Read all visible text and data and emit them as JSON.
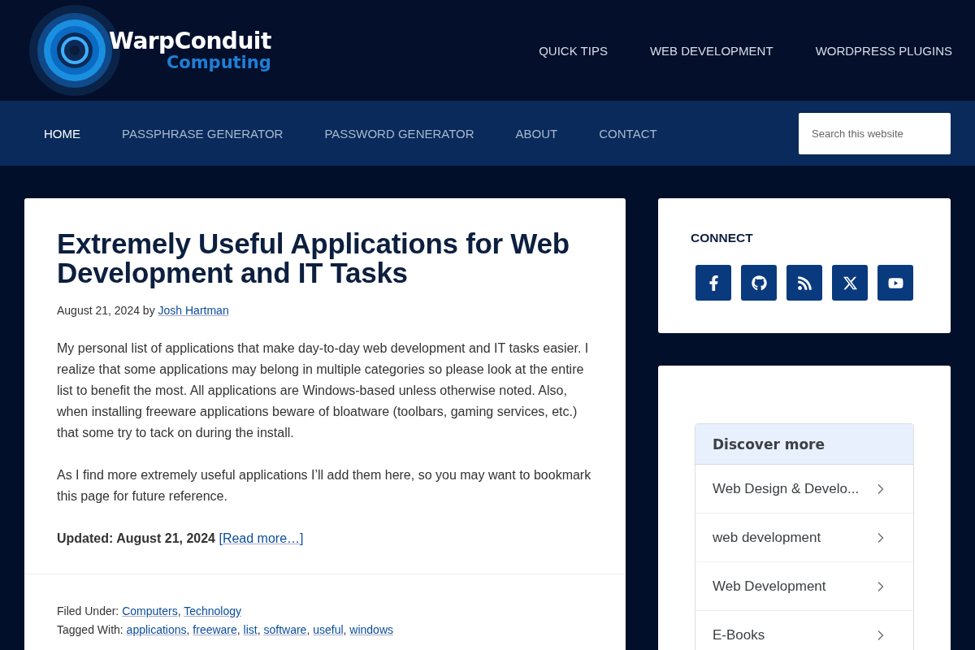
{
  "logo": {
    "name": "WarpConduit",
    "tagline": "Computing"
  },
  "top_nav": [
    "QUICK TIPS",
    "WEB DEVELOPMENT",
    "WORDPRESS PLUGINS"
  ],
  "main_nav": [
    {
      "label": "HOME",
      "selected": true
    },
    {
      "label": "PASSPHRASE GENERATOR",
      "selected": false
    },
    {
      "label": "PASSWORD GENERATOR",
      "selected": false
    },
    {
      "label": "ABOUT",
      "selected": false
    },
    {
      "label": "CONTACT",
      "selected": false
    }
  ],
  "search": {
    "placeholder": "Search this website"
  },
  "article": {
    "title": "Extremely Useful Applications for Web Development and IT Tasks",
    "meta": {
      "date_by": "August 21, 2024 by",
      "author": "Josh Hartman"
    },
    "paragraphs": [
      "My personal list of applications that make day-to-day web development and IT tasks easier. I realize that some applications may belong in multiple categories so please look at the entire list to benefit the most. All applications are Windows-based unless otherwise noted. Also, when installing freeware applications beware of bloatware (toolbars, gaming services, etc.) that some try to tack on during the install.",
      "As I find more extremely useful applications I’ll add them here, so you may want to bookmark this page for future reference."
    ],
    "updated": "Updated: August 21, 2024",
    "read_more": "[Read more…]",
    "filed_under": {
      "label": "Filed Under:",
      "separator": ",",
      "links": [
        "Computers",
        "Technology"
      ]
    },
    "tagged_with": {
      "label": "Tagged With:",
      "separator": ",",
      "links": [
        "applications",
        "freeware",
        "list",
        "software",
        "useful",
        "windows"
      ]
    }
  },
  "connect": {
    "title": "CONNECT",
    "icons": [
      {
        "kind": "facebook"
      },
      {
        "kind": "github"
      },
      {
        "kind": "rss"
      },
      {
        "kind": "x"
      },
      {
        "kind": "youtube"
      }
    ]
  },
  "discover": {
    "title": "Discover more",
    "items": [
      "Web Design & Develo...",
      "web development",
      "Web Development",
      "E-Books"
    ]
  }
}
